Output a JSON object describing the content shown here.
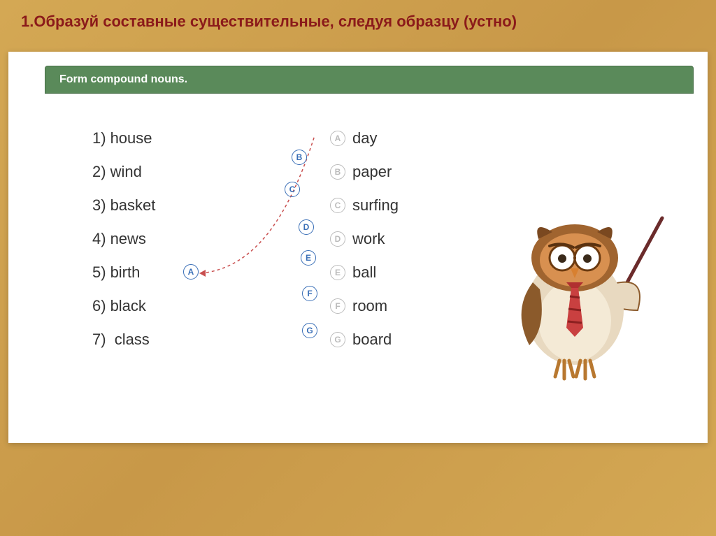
{
  "title": "1.Образуй составные существительные, следуя образцу (устно)",
  "greenBar": "Form compound nouns.",
  "left": [
    {
      "num": "1)",
      "word": "house"
    },
    {
      "num": "2)",
      "word": "wind"
    },
    {
      "num": "3)",
      "word": "basket"
    },
    {
      "num": "4)",
      "word": "news"
    },
    {
      "num": "5)",
      "word": "birth"
    },
    {
      "num": "6)",
      "word": "black"
    },
    {
      "num": "7)",
      "word": "class"
    }
  ],
  "right": [
    {
      "letter": "A",
      "word": "day"
    },
    {
      "letter": "B",
      "word": "paper"
    },
    {
      "letter": "C",
      "word": "surfing"
    },
    {
      "letter": "D",
      "word": "work"
    },
    {
      "letter": "E",
      "word": "ball"
    },
    {
      "letter": "F",
      "word": "room"
    },
    {
      "letter": "G",
      "word": "board"
    }
  ],
  "answers": {
    "row5": "A",
    "markers": [
      "B",
      "C",
      "D",
      "E",
      "F",
      "G"
    ]
  }
}
